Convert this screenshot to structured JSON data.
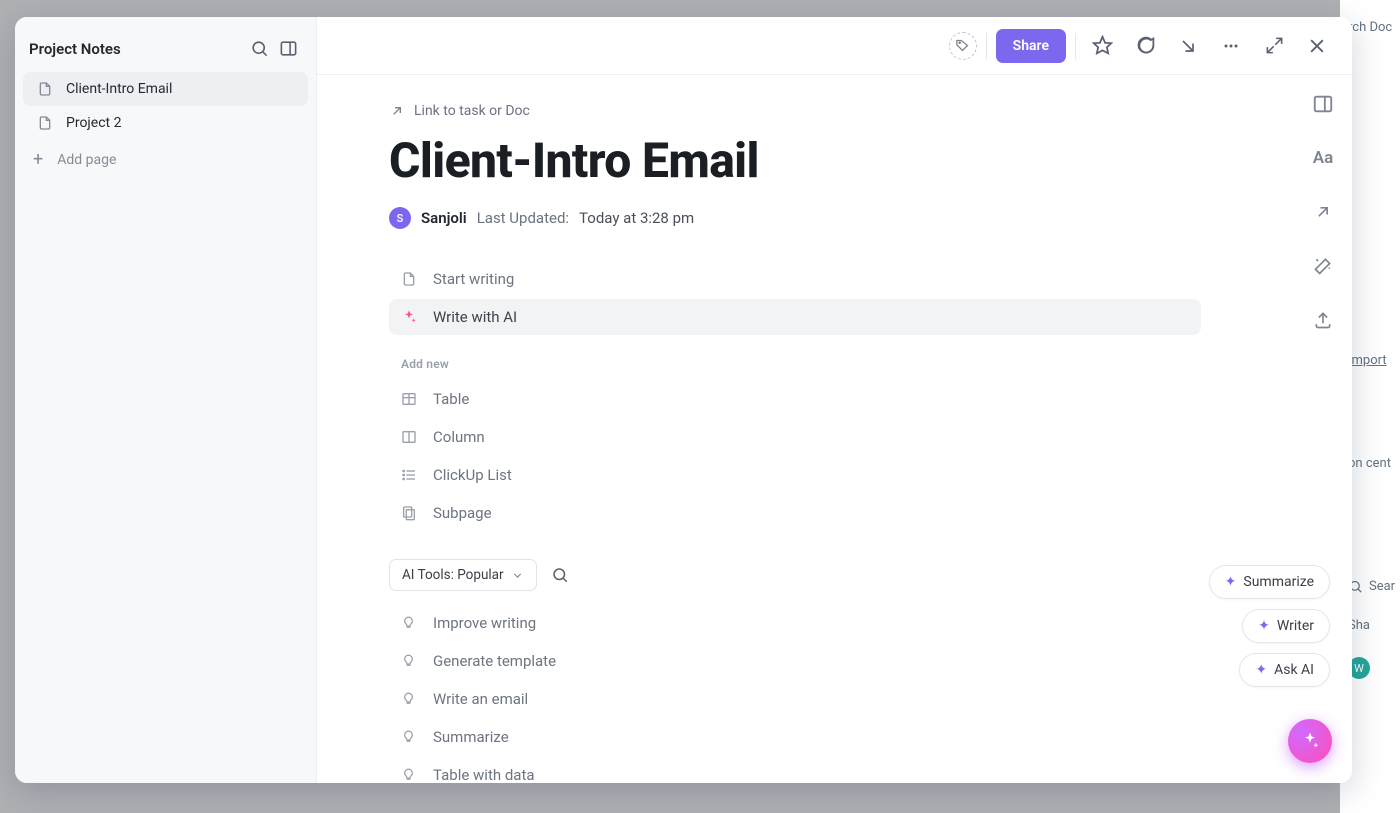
{
  "background": {
    "search_doc": "rch Doc",
    "import": "Import",
    "center": "on cent",
    "search": "Sear",
    "share_short": "Sha",
    "avatar_letter": "W"
  },
  "sidebar": {
    "title": "Project Notes",
    "pages": [
      {
        "label": "Client-Intro Email",
        "active": true
      },
      {
        "label": "Project 2",
        "active": false
      }
    ],
    "add_page": "Add page"
  },
  "topbar": {
    "share": "Share"
  },
  "doc": {
    "link_hint": "Link to task or Doc",
    "title": "Client-Intro Email",
    "author_initial": "S",
    "author": "Sanjoli",
    "updated_label": "Last Updated:",
    "updated_value": "Today at 3:28 pm"
  },
  "options": {
    "start_writing": "Start writing",
    "write_ai": "Write with AI"
  },
  "add_new": {
    "label": "Add new",
    "items": {
      "table": "Table",
      "column": "Column",
      "clickup_list": "ClickUp List",
      "subpage": "Subpage"
    }
  },
  "ai_tools": {
    "dropdown": "AI Tools: Popular",
    "items": {
      "improve": "Improve writing",
      "template": "Generate template",
      "email": "Write an email",
      "summarize": "Summarize",
      "table_data": "Table with data"
    }
  },
  "chips": {
    "summarize": "Summarize",
    "writer": "Writer",
    "ask_ai": "Ask AI"
  },
  "right_rail": {
    "text_style": "Aa"
  }
}
